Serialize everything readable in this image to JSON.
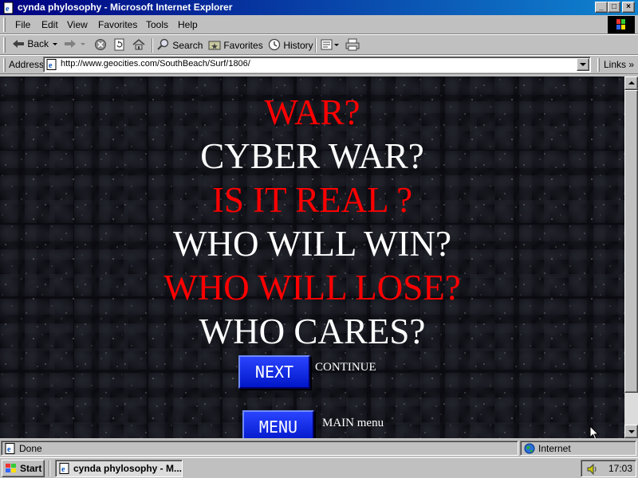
{
  "window": {
    "title": "cynda phylosophy - Microsoft Internet Explorer",
    "controls": {
      "minimize": "_",
      "maximize": "□",
      "close": "×"
    }
  },
  "menu": [
    "File",
    "Edit",
    "View",
    "Favorites",
    "Tools",
    "Help"
  ],
  "toolbar": {
    "back": "Back",
    "search": "Search",
    "favorites": "Favorites",
    "history": "History"
  },
  "address": {
    "label": "Address",
    "url": "http://www.geocities.com/SouthBeach/Surf/1806/",
    "links": "Links"
  },
  "page": {
    "lines": [
      {
        "text": "WAR?",
        "color": "#ff0000"
      },
      {
        "text": "CYBER WAR?",
        "color": "#ffffff"
      },
      {
        "text": "IS IT REAL ?",
        "color": "#ff0000"
      },
      {
        "text": "WHO WILL WIN?",
        "color": "#ffffff"
      },
      {
        "text": "WHO WILL LOSE?",
        "color": "#ff0000"
      },
      {
        "text": "WHO CARES?",
        "color": "#ffffff"
      }
    ],
    "next_button": "NEXT",
    "next_label": "CONTINUE",
    "menu_button": "MENU",
    "menu_label": "MAIN menu"
  },
  "status": {
    "text": "Done",
    "zone": "Internet"
  },
  "taskbar": {
    "start": "Start",
    "task": "cynda phylosophy - M...",
    "clock": "17:03"
  }
}
